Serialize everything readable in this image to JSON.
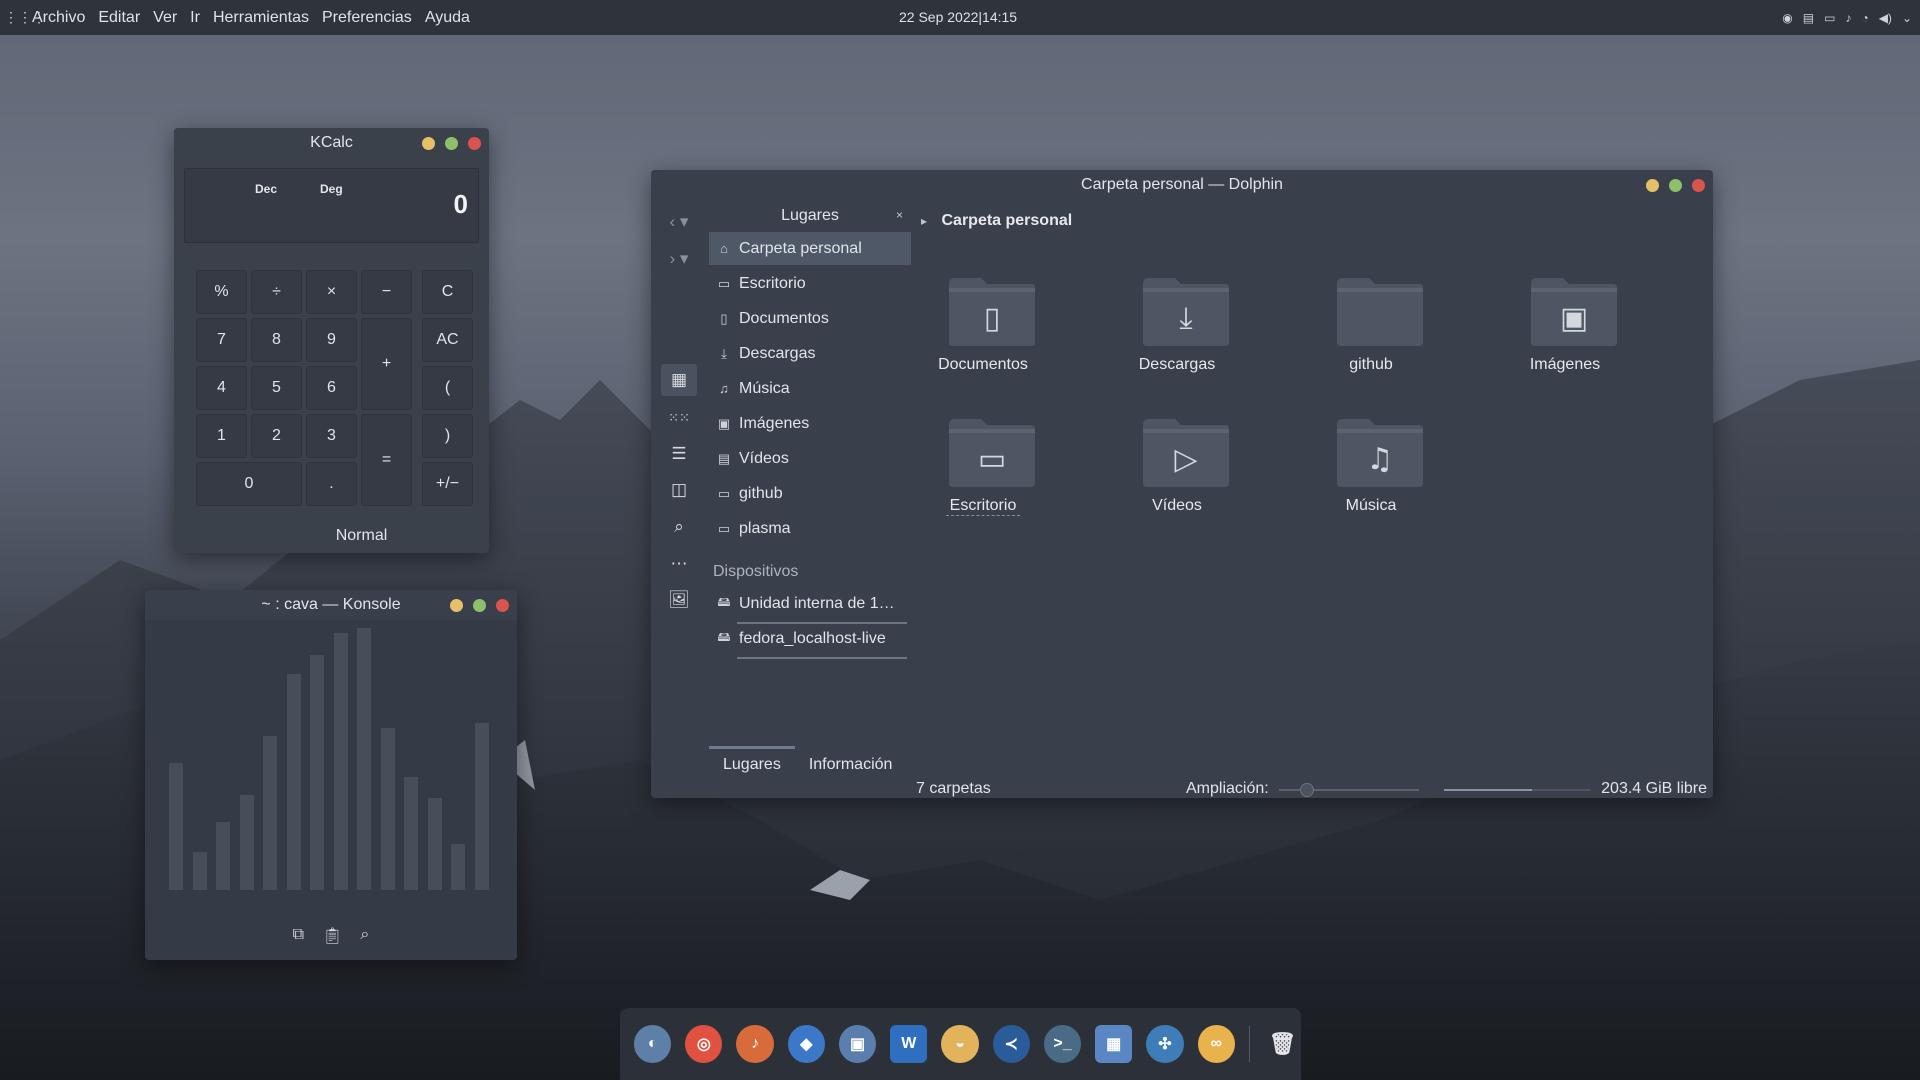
{
  "top_panel": {
    "menu": [
      "Archivo",
      "Editar",
      "Ver",
      "Ir",
      "Herramientas",
      "Preferencias",
      "Ayuda"
    ],
    "clock": "22 Sep 2022|14:15"
  },
  "kcalc": {
    "title": "KCalc",
    "display": {
      "base": "Dec",
      "angle": "Deg",
      "value": "0"
    },
    "buttons": {
      "percent": "%",
      "divide": "÷",
      "multiply": "×",
      "minus": "−",
      "clear": "C",
      "seven": "7",
      "eight": "8",
      "nine": "9",
      "plus": "+",
      "all_clear": "AC",
      "four": "4",
      "five": "5",
      "six": "6",
      "open_paren": "(",
      "one": "1",
      "two": "2",
      "three": "3",
      "equals": "=",
      "close_paren": ")",
      "zero": "0",
      "dot": ".",
      "sign": "+/−"
    },
    "mode": "Normal"
  },
  "konsole": {
    "title": "~ : cava — Konsole",
    "levels": [
      0.47,
      0.14,
      0.25,
      0.35,
      0.57,
      0.8,
      0.87,
      0.95,
      0.97,
      0.6,
      0.42,
      0.34,
      0.17,
      0.62
    ]
  },
  "dolphin": {
    "title": "Carpeta personal — Dolphin",
    "places_title": "Lugares",
    "places": [
      {
        "label": "Carpeta personal",
        "active": true
      },
      {
        "label": "Escritorio"
      },
      {
        "label": "Documentos"
      },
      {
        "label": "Descargas"
      },
      {
        "label": "Música"
      },
      {
        "label": "Imágenes"
      },
      {
        "label": "Vídeos"
      },
      {
        "label": "github"
      },
      {
        "label": "plasma"
      }
    ],
    "devices_title": "Dispositivos",
    "devices": [
      "Unidad interna de 1…",
      "fedora_localhost-live"
    ],
    "tabs": [
      "Lugares",
      "Información"
    ],
    "breadcrumb": "Carpeta personal",
    "folders": [
      "Documentos",
      "Descargas",
      "github",
      "Imágenes",
      "Escritorio",
      "Vídeos",
      "Música"
    ],
    "status": {
      "count": "7 carpetas",
      "zoom_label": "Ampliación:",
      "free": "203.4 GiB libre",
      "zoom_level": 0.2,
      "disk_used_fraction": 0.6
    }
  },
  "colors": {
    "btn_close": "#d9534f",
    "btn_max": "#8fbf6a",
    "btn_min": "#e5c068",
    "accent": "#4f5867"
  }
}
